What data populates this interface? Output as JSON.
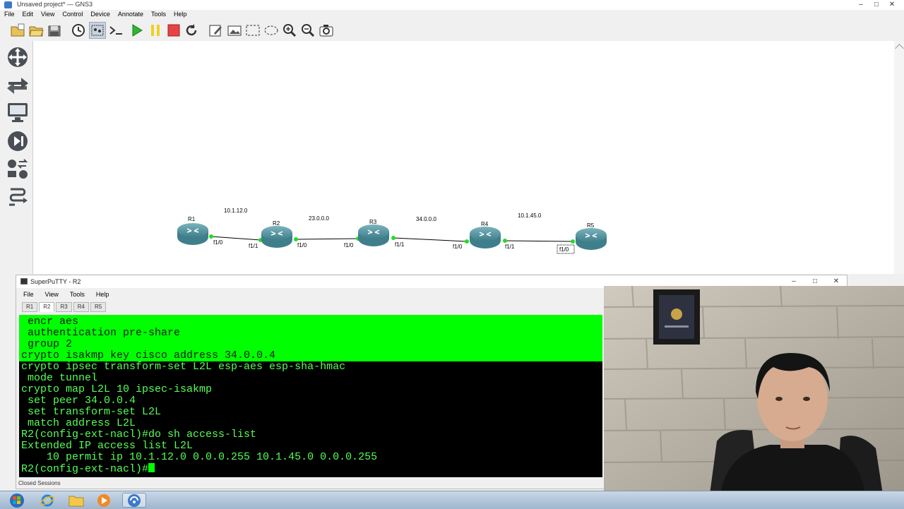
{
  "gns3": {
    "window_title": "Unsaved project* — GNS3",
    "menu": [
      "File",
      "Edit",
      "View",
      "Control",
      "Device",
      "Annotate",
      "Tools",
      "Help"
    ],
    "window_controls": {
      "minimize": "–",
      "maximize": "□",
      "close": "✕"
    },
    "toolbar_icons": [
      "new-project-icon",
      "open-project-icon",
      "save-project-icon",
      "snapshot-icon",
      "show-interface-labels-icon",
      "console-all-icon",
      "start-all-icon",
      "suspend-all-icon",
      "stop-all-icon",
      "reload-all-icon",
      "add-note-icon",
      "insert-picture-icon",
      "draw-rectangle-icon",
      "draw-ellipse-icon",
      "zoom-in-icon",
      "zoom-out-icon",
      "screenshot-icon"
    ],
    "dock_icons": [
      "browse-routers-icon",
      "browse-switches-icon",
      "browse-end-devices-icon",
      "browse-security-devices-icon",
      "browse-all-devices-icon",
      "add-link-icon"
    ]
  },
  "topology": {
    "nodes": [
      {
        "name": "R1"
      },
      {
        "name": "R2"
      },
      {
        "name": "R3"
      },
      {
        "name": "R4"
      },
      {
        "name": "R5"
      }
    ],
    "networks": [
      "10.1.12.0",
      "23.0.0.0",
      "34.0.0.0",
      "10.1.45.0"
    ],
    "interfaces": {
      "r1_right": "f1/0",
      "r2_left": "f1/1",
      "r2_right": "f1/0",
      "r3_left": "f1/0",
      "r3_right": "f1/1",
      "r4_left": "f1/0",
      "r4_right": "f1/1",
      "r5_left": "f1/0"
    },
    "link_status_color": "#22dd22"
  },
  "superputty": {
    "title": "SuperPuTTY - R2",
    "menu": [
      "File",
      "View",
      "Tools",
      "Help"
    ],
    "tabs": [
      "R1",
      "R2",
      "R3",
      "R4",
      "R5"
    ],
    "active_tab": "R2",
    "window_controls": {
      "minimize": "–",
      "maximize": "□",
      "close": "✕"
    },
    "status": "Closed Sessions",
    "terminal_highlighted": [
      " encr aes",
      " authentication pre-share",
      " group 2",
      "crypto isakmp key cisco address 34.0.0.4"
    ],
    "terminal_lines": [
      "crypto ipsec transform-set L2L esp-aes esp-sha-hmac",
      " mode tunnel",
      "crypto map L2L 10 ipsec-isakmp",
      " set peer 34.0.0.4",
      " set transform-set L2L",
      " match address L2L",
      "R2(config-ext-nacl)#do sh access-list",
      "Extended IP access list L2L",
      "    10 permit ip 10.1.12.0 0.0.0.255 10.1.45.0 0.0.0.255"
    ],
    "prompt": "R2(config-ext-nacl)#",
    "terminal_fg": "#55ff55",
    "highlight_bg": "#00ff00"
  },
  "taskbar": {
    "items": [
      "start-button-icon",
      "internet-explorer-icon",
      "file-explorer-icon",
      "media-player-icon",
      "gns3-taskbar-icon"
    ]
  }
}
